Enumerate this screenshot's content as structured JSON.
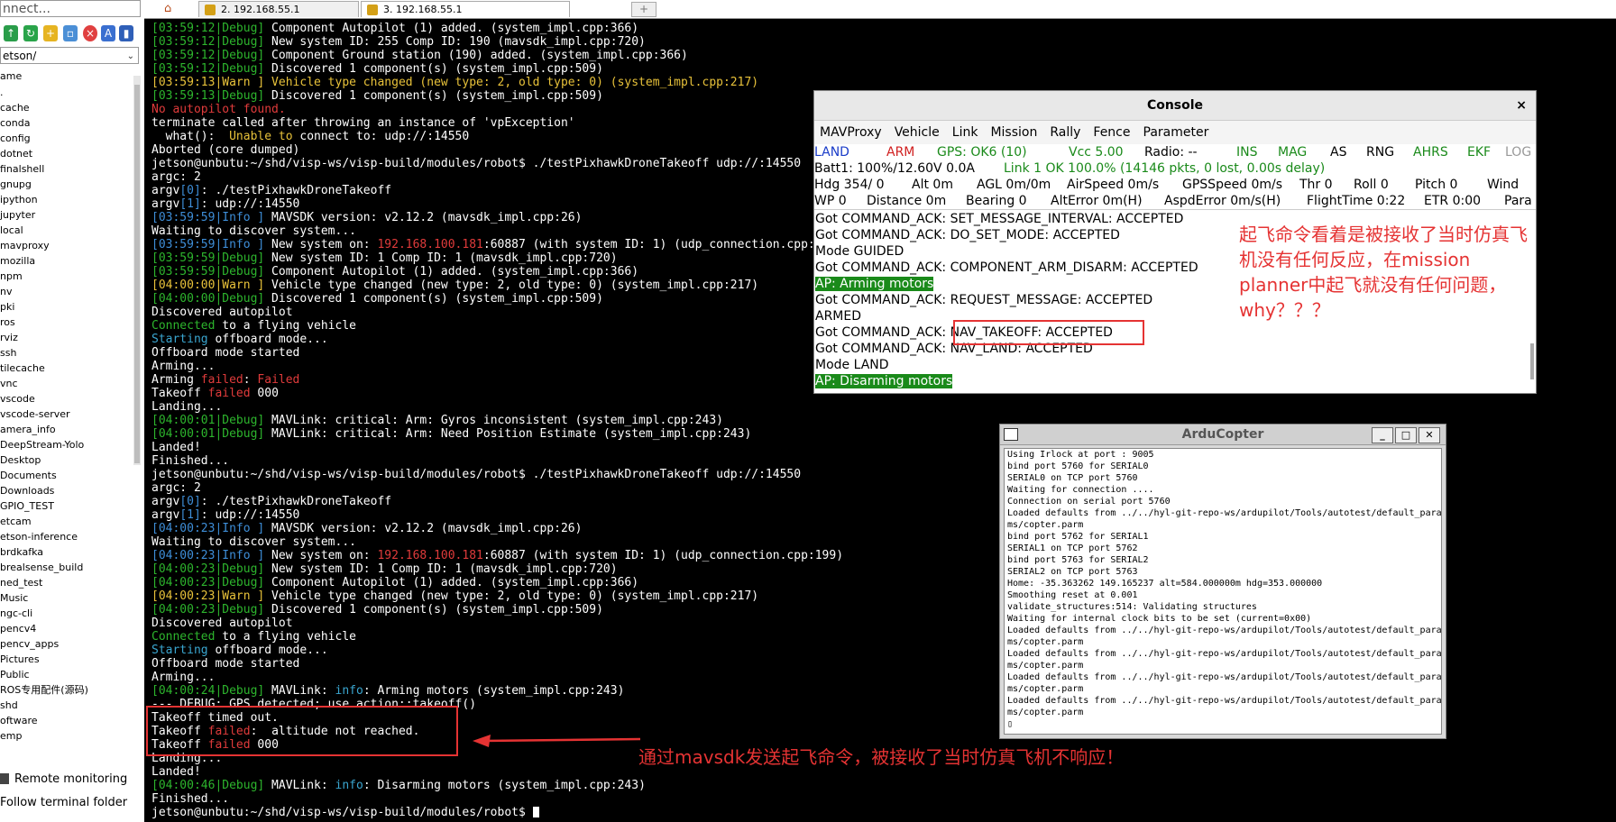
{
  "left_panel": {
    "connect_text": "nnect...",
    "path_value": "etson/",
    "name_header": "ame",
    "files": [
      ".",
      "cache",
      "conda",
      "config",
      "dotnet",
      "finalshell",
      "gnupg",
      "ipython",
      "jupyter",
      "local",
      "mavproxy",
      "mozilla",
      "npm",
      "nv",
      "pki",
      "ros",
      "rviz",
      "ssh",
      "tilecache",
      "vnc",
      "vscode",
      "vscode-server",
      "amera_info",
      "DeepStream-Yolo",
      "Desktop",
      "Documents",
      "Downloads",
      "GPIO_TEST",
      "etcam",
      "etson-inference",
      "brdkafka",
      "brealsense_build",
      "ned_test",
      "Music",
      "ngc-cli",
      "pencv4",
      "pencv_apps",
      "Pictures",
      "Public",
      "ROS专用配件(源码)",
      "shd",
      "oftware",
      "emp"
    ],
    "remote_monitoring": "Remote monitoring",
    "follow_terminal": "Follow terminal folder"
  },
  "tabs": [
    {
      "label": "2. 192.168.55.1"
    },
    {
      "label": "3. 192.168.55.1"
    }
  ],
  "terminal_lines": [
    [
      [
        "[03:59:12|Debug]",
        "green"
      ],
      [
        " Component Autopilot (1) added. (system_impl.cpp:366)",
        "white"
      ]
    ],
    [
      [
        "[03:59:12|Debug]",
        "green"
      ],
      [
        " New system ID: 255 Comp ID: 190 (mavsdk_impl.cpp:720)",
        "white"
      ]
    ],
    [
      [
        "[03:59:12|Debug]",
        "green"
      ],
      [
        " Component Ground station (190) added. (system_impl.cpp:366)",
        "white"
      ]
    ],
    [
      [
        "[03:59:12|Debug]",
        "green"
      ],
      [
        " Discovered 1 component(s) (system_impl.cpp:509)",
        "white"
      ]
    ],
    [
      [
        "[03:59:13|Warn ]",
        "yellow"
      ],
      [
        " Vehicle type changed (new type: 2, old type: 0) (system_impl.cpp:217)",
        "yellow"
      ]
    ],
    [
      [
        "[03:59:13|Debug]",
        "green"
      ],
      [
        " Discovered 1 component(s) (system_impl.cpp:509)",
        "white"
      ]
    ],
    [
      [
        "No autopilot found.",
        "red"
      ]
    ],
    [
      [
        "terminate called after throwing an instance of 'vpException'",
        "white"
      ]
    ],
    [
      [
        "  what():  ",
        "white"
      ],
      [
        "Unable to",
        "yellow"
      ],
      [
        " connect to: udp://:14550",
        "white"
      ]
    ],
    [
      [
        "Aborted (core dumped)",
        "white"
      ]
    ],
    [
      [
        "jetson@unbutu:~/shd/visp-ws/visp-build/modules/robot$ ./testPixhawkDroneTakeoff udp://:14550",
        "white"
      ]
    ],
    [
      [
        "argc: 2",
        "white"
      ]
    ],
    [
      [
        "argv",
        "white"
      ],
      [
        "[0]",
        "blue"
      ],
      [
        ": ./testPixhawkDroneTakeoff",
        "white"
      ]
    ],
    [
      [
        "argv",
        "white"
      ],
      [
        "[1]",
        "blue"
      ],
      [
        ": udp://:14550",
        "white"
      ]
    ],
    [
      [
        "[03:59:59|Info ]",
        "blue"
      ],
      [
        " MAVSDK version: v2.12.2 (mavsdk_impl.cpp:26)",
        "white"
      ]
    ],
    [
      [
        "Waiting to discover system...",
        "white"
      ]
    ],
    [
      [
        "[03:59:59|Info ]",
        "blue"
      ],
      [
        " New system on: ",
        "white"
      ],
      [
        "192.168.100.181",
        "red"
      ],
      [
        ":60887 (with system ID: 1) (udp_connection.cpp:199)",
        "white"
      ]
    ],
    [
      [
        "[03:59:59|Debug]",
        "green"
      ],
      [
        " New system ID: 1 Comp ID: 1 (mavsdk_impl.cpp:720)",
        "white"
      ]
    ],
    [
      [
        "[03:59:59|Debug]",
        "green"
      ],
      [
        " Component Autopilot (1) added. (system_impl.cpp:366)",
        "white"
      ]
    ],
    [
      [
        "[04:00:00|Warn ]",
        "yellow"
      ],
      [
        " Vehicle type changed (new type: 2, old type: 0) (system_impl.cpp:217)",
        "white"
      ]
    ],
    [
      [
        "[04:00:00|Debug]",
        "green"
      ],
      [
        " Discovered 1 component(s) (system_impl.cpp:509)",
        "white"
      ]
    ],
    [
      [
        "Discovered autopilot",
        "white"
      ]
    ],
    [
      [
        "Connected",
        "green"
      ],
      [
        " to a flying vehicle",
        "white"
      ]
    ],
    [
      [
        "Starting",
        "cyan"
      ],
      [
        " offboard mode...",
        "white"
      ]
    ],
    [
      [
        "Offboard mode started",
        "white"
      ]
    ],
    [
      [
        "Arming...",
        "white"
      ]
    ],
    [
      [
        "Arming ",
        "white"
      ],
      [
        "failed",
        "red"
      ],
      [
        ": ",
        "white"
      ],
      [
        "Failed",
        "red"
      ]
    ],
    [
      [
        "Takeoff ",
        "white"
      ],
      [
        "failed",
        "red"
      ],
      [
        " 000",
        "white"
      ]
    ],
    [
      [
        "Landing...",
        "white"
      ]
    ],
    [
      [
        "[04:00:01|Debug]",
        "green"
      ],
      [
        " MAVLink: critical: Arm: Gyros inconsistent (system_impl.cpp:243)",
        "white"
      ]
    ],
    [
      [
        "[04:00:01|Debug]",
        "green"
      ],
      [
        " MAVLink: critical: Arm: Need Position Estimate (system_impl.cpp:243)",
        "white"
      ]
    ],
    [
      [
        "Landed!",
        "white"
      ]
    ],
    [
      [
        "Finished...",
        "white"
      ]
    ],
    [
      [
        "jetson@unbutu:~/shd/visp-ws/visp-build/modules/robot$ ./testPixhawkDroneTakeoff udp://:14550",
        "white"
      ]
    ],
    [
      [
        "argc: 2",
        "white"
      ]
    ],
    [
      [
        "argv",
        "white"
      ],
      [
        "[0]",
        "blue"
      ],
      [
        ": ./testPixhawkDroneTakeoff",
        "white"
      ]
    ],
    [
      [
        "argv",
        "white"
      ],
      [
        "[1]",
        "blue"
      ],
      [
        ": udp://:14550",
        "white"
      ]
    ],
    [
      [
        "[04:00:23|Info ]",
        "blue"
      ],
      [
        " MAVSDK version: v2.12.2 (mavsdk_impl.cpp:26)",
        "white"
      ]
    ],
    [
      [
        "Waiting to discover system...",
        "white"
      ]
    ],
    [
      [
        "[04:00:23|Info ]",
        "blue"
      ],
      [
        " New system on: ",
        "white"
      ],
      [
        "192.168.100.181",
        "red"
      ],
      [
        ":60887 (with system ID: 1) (udp_connection.cpp:199)",
        "white"
      ]
    ],
    [
      [
        "[04:00:23|Debug]",
        "green"
      ],
      [
        " New system ID: 1 Comp ID: 1 (mavsdk_impl.cpp:720)",
        "white"
      ]
    ],
    [
      [
        "[04:00:23|Debug]",
        "green"
      ],
      [
        " Component Autopilot (1) added. (system_impl.cpp:366)",
        "white"
      ]
    ],
    [
      [
        "[04:00:23|Warn ]",
        "yellow"
      ],
      [
        " Vehicle type changed (new type: 2, old type: 0) (system_impl.cpp:217)",
        "white"
      ]
    ],
    [
      [
        "[04:00:23|Debug]",
        "green"
      ],
      [
        " Discovered 1 component(s) (system_impl.cpp:509)",
        "white"
      ]
    ],
    [
      [
        "Discovered autopilot",
        "white"
      ]
    ],
    [
      [
        "Connected",
        "green"
      ],
      [
        " to a flying vehicle",
        "white"
      ]
    ],
    [
      [
        "Starting",
        "cyan"
      ],
      [
        " offboard mode...",
        "white"
      ]
    ],
    [
      [
        "Offboard mode started",
        "white"
      ]
    ],
    [
      [
        "Arming...",
        "white"
      ]
    ],
    [
      [
        "[04:00:24|Debug]",
        "green"
      ],
      [
        " MAVLink: ",
        "white"
      ],
      [
        "info",
        "cyan"
      ],
      [
        ": Arming motors (system_impl.cpp:243)",
        "white"
      ]
    ],
    [
      [
        "--- DEBUG: GPS detected; use action::takeoff()",
        "white"
      ]
    ],
    [
      [
        "Takeoff timed out.",
        "white"
      ]
    ],
    [
      [
        "Takeoff ",
        "white"
      ],
      [
        "failed",
        "red"
      ],
      [
        ":  altitude not reached.",
        "white"
      ]
    ],
    [
      [
        "Takeoff ",
        "white"
      ],
      [
        "failed",
        "red"
      ],
      [
        " 000",
        "white"
      ]
    ],
    [
      [
        "Landing...",
        "white"
      ]
    ],
    [
      [
        "Landed!",
        "white"
      ]
    ],
    [
      [
        "[04:00:46|Debug]",
        "green"
      ],
      [
        " MAVLink: ",
        "white"
      ],
      [
        "info",
        "cyan"
      ],
      [
        ": Disarming motors (system_impl.cpp:243)",
        "white"
      ]
    ],
    [
      [
        "Finished...",
        "white"
      ]
    ],
    [
      [
        "jetson@unbutu:~/shd/visp-ws/visp-build/modules/robot$ ",
        "white"
      ]
    ]
  ],
  "console": {
    "title": "Console",
    "close": "×",
    "menu": [
      "MAVProxy",
      "Vehicle",
      "Link",
      "Mission",
      "Rally",
      "Fence",
      "Parameter"
    ],
    "status_rows": [
      [
        [
          "LAND",
          "#1a3cc8",
          0
        ],
        [
          "ARM",
          "#d02020",
          80
        ],
        [
          "GPS: OK6 (10)",
          "#1a8a1a",
          136
        ],
        [
          "Vcc 5.00",
          "#1a8a1a",
          282
        ],
        [
          "Radio: --",
          "#000000",
          366
        ],
        [
          "INS",
          "#1a8a1a",
          468
        ],
        [
          "MAG",
          "#1a8a1a",
          514
        ],
        [
          "AS",
          "#000000",
          572
        ],
        [
          "RNG",
          "#000000",
          612
        ],
        [
          "AHRS",
          "#1a8a1a",
          664
        ],
        [
          "EKF",
          "#1a8a1a",
          724
        ],
        [
          "LOG",
          "#999999",
          766
        ]
      ],
      [
        [
          "Batt1: 100%/12.60V 0.0A",
          "#000000",
          0
        ],
        [
          "Link 1 OK 100.0% (14146 pkts, 0 lost, 0.00s delay)",
          "#1a8a1a",
          210
        ]
      ],
      [
        [
          "Hdg 354/  0",
          "#000000",
          0
        ],
        [
          "Alt 0m",
          "#000000",
          108
        ],
        [
          "AGL 0m/0m",
          "#000000",
          180
        ],
        [
          "AirSpeed 0m/s",
          "#000000",
          280
        ],
        [
          "GPSSpeed 0m/s",
          "#000000",
          408
        ],
        [
          "Thr 0",
          "#000000",
          538
        ],
        [
          "Roll 0",
          "#000000",
          598
        ],
        [
          "Pitch 0",
          "#000000",
          666
        ],
        [
          "Wind",
          "#000000",
          746
        ]
      ],
      [
        [
          "WP 0",
          "#000000",
          0
        ],
        [
          "Distance 0m",
          "#000000",
          58
        ],
        [
          "Bearing 0",
          "#000000",
          168
        ],
        [
          "AltError 0m(H)",
          "#000000",
          262
        ],
        [
          "AspdError 0m/s(H)",
          "#000000",
          388
        ],
        [
          "FlightTime 0:22",
          "#000000",
          546
        ],
        [
          "ETR 0:00",
          "#000000",
          676
        ],
        [
          "Para",
          "#000000",
          765
        ]
      ]
    ],
    "log": [
      [
        "Got COMMAND_ACK: SET_MESSAGE_INTERVAL: ACCEPTED",
        ""
      ],
      [
        "Got COMMAND_ACK: DO_SET_MODE: ACCEPTED",
        ""
      ],
      [
        "Mode GUIDED",
        ""
      ],
      [
        "Got COMMAND_ACK: COMPONENT_ARM_DISARM: ACCEPTED",
        ""
      ],
      [
        "AP: Arming motors",
        "green"
      ],
      [
        "Got COMMAND_ACK: REQUEST_MESSAGE: ACCEPTED",
        ""
      ],
      [
        "ARMED",
        ""
      ],
      [
        "Got COMMAND_ACK: NAV_TAKEOFF: ACCEPTED",
        ""
      ],
      [
        "Got COMMAND_ACK: NAV_LAND: ACCEPTED",
        ""
      ],
      [
        "Mode LAND",
        ""
      ],
      [
        "AP: Disarming motors",
        "green"
      ]
    ]
  },
  "ardu": {
    "title": "ArduCopter",
    "btn_min": "_",
    "btn_max": "□",
    "btn_close": "✕",
    "lines": [
      "Using Irlock at port : 9005",
      "bind port 5760 for SERIAL0",
      "SERIAL0 on TCP port 5760",
      "Waiting for connection ....",
      "Connection on serial port 5760",
      "Loaded defaults from ../../hyl-git-repo-ws/ardupilot/Tools/autotest/default_para",
      "ms/copter.parm",
      "bind port 5762 for SERIAL1",
      "SERIAL1 on TCP port 5762",
      "bind port 5763 for SERIAL2",
      "SERIAL2 on TCP port 5763",
      "Home: -35.363262 149.165237 alt=584.000000m hdg=353.000000",
      "Smoothing reset at 0.001",
      "validate_structures:514: Validating structures",
      "Waiting for internal clock bits to be set (current=0x00)",
      "Loaded defaults from ../../hyl-git-repo-ws/ardupilot/Tools/autotest/default_para",
      "ms/copter.parm",
      "Loaded defaults from ../../hyl-git-repo-ws/ardupilot/Tools/autotest/default_para",
      "ms/copter.parm",
      "Loaded defaults from ../../hyl-git-repo-ws/ardupilot/Tools/autotest/default_para",
      "ms/copter.parm",
      "Loaded defaults from ../../hyl-git-repo-ws/ardupilot/Tools/autotest/default_para",
      "ms/copter.parm",
      "▯"
    ]
  },
  "annotations": {
    "top_right": "起飞命令看着是被接收了当时仿真飞机没有任何反应，在mission planner中起飞就没有任何问题，why？？？",
    "bottom": "通过mavsdk发送起飞命令，被接收了当时仿真飞机不响应！"
  },
  "colors": {
    "annotation": "#e53333",
    "terminal_bg": "#000000",
    "console_green": "#1a8a1a"
  }
}
